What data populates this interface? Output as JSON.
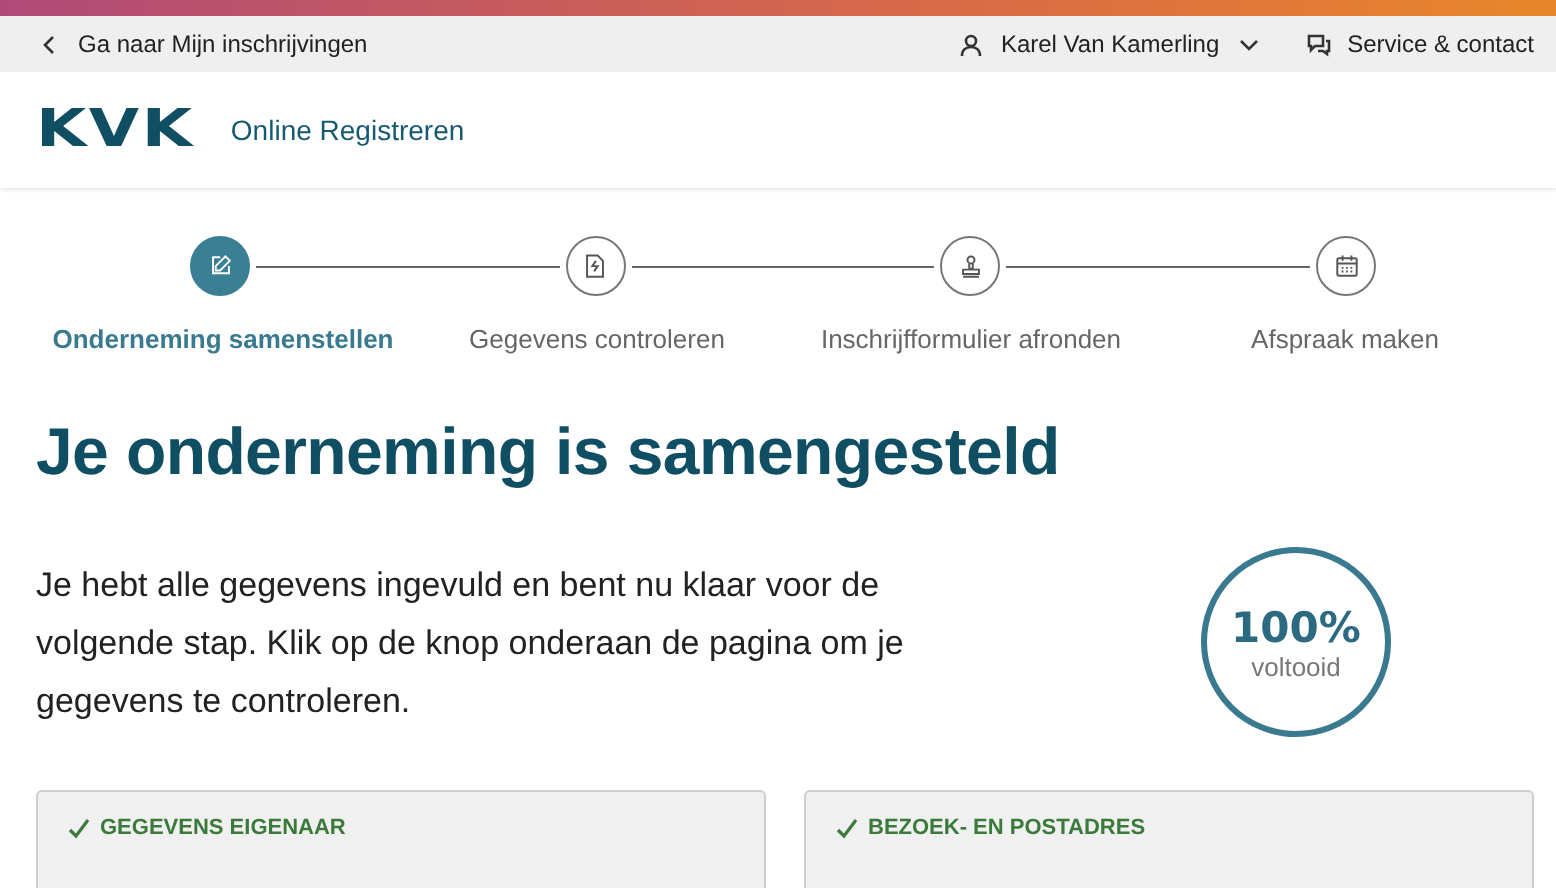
{
  "top_bar": {
    "back_link": "Ga naar Mijn inschrijvingen",
    "user": "Karel Van Kamerling",
    "service": "Service & contact"
  },
  "header": {
    "logo": "KVK",
    "app_name": "Online Registreren"
  },
  "steps": [
    {
      "label": "Onderneming samenstellen",
      "selected": true
    },
    {
      "label": "Gegevens controleren",
      "selected": false
    },
    {
      "label": "Inschrijfformulier afronden",
      "selected": false
    },
    {
      "label": "Afspraak maken",
      "selected": false
    }
  ],
  "title": "Je onderneming is samengesteld",
  "intro": "Je hebt alle gegevens ingevuld en bent nu klaar voor de volgende stap. Klik op de knop onderaan de pagina om je gegevens te controleren.",
  "progress": {
    "value": "100%",
    "caption": "voltooid"
  },
  "cards": [
    {
      "title": "GEGEVENS EIGENAAR",
      "checked": true
    },
    {
      "title": "BEZOEK- EN POSTADRES",
      "checked": true
    }
  ]
}
